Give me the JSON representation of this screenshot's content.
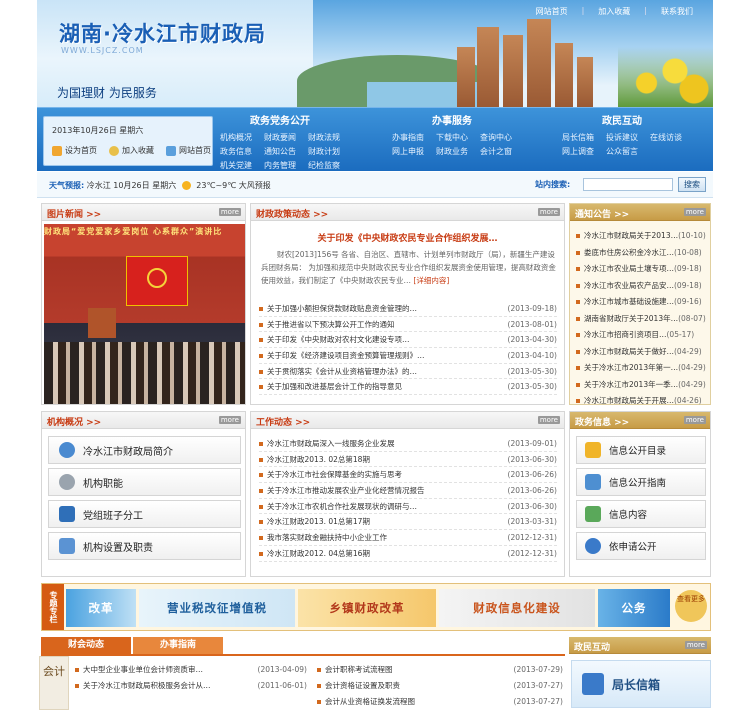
{
  "header": {
    "title": "湖南·冷水江市财政局",
    "subtitle_en": "WWW.LSJCZ.COM",
    "slogan": "为国理财    为民服务",
    "toplinks": [
      "网站首页",
      "加入收藏",
      "联系我们"
    ]
  },
  "datebox": {
    "date": "2013年10月26日  星期六",
    "quick": [
      "设为首页",
      "加入收藏",
      "网站首页"
    ]
  },
  "nav": [
    {
      "title": "政务党务公开",
      "items": [
        "机构概况",
        "财政要闻",
        "财政法规",
        "政务信息",
        "通知公告",
        "财政计划",
        "机关党建",
        "内务管理",
        "纪检监察"
      ]
    },
    {
      "title": "办事服务",
      "items": [
        "办事指南",
        "下载中心",
        "查询中心",
        "网上申报",
        "财政业务",
        "会计之窗"
      ]
    },
    {
      "title": "政民互动",
      "items": [
        "局长信箱",
        "投诉建议",
        "在线访谈",
        "网上调查",
        "公众留言"
      ]
    }
  ],
  "weather": {
    "label": "天气预报:",
    "text_left": "冷水江  10月26日  星期六",
    "temp": "23℃~9℃",
    "cond": "大风预报",
    "search_label": "站内搜索:",
    "search_placeholder": "",
    "search_btn": "搜索"
  },
  "photo_news": {
    "title": "图片新闻 >>",
    "more": "more",
    "banner": "财政局“爱党爱家乡爱岗位 心系群众”演讲比"
  },
  "policy": {
    "title": "财政政策动态 >>",
    "more": "more",
    "headline": "关于印发《中央财政农民专业合作组织发展…",
    "body_1": "财农[2013]156号 各省、自治区、直辖市、计划单列市财政厅（局），新疆生产建设兵团财务局：",
    "body_2": "为加强和规范中央财政农民专业合作组织发展资金使用管理，提高财政资金使用效益，我们制定了《中央财政农民专业…",
    "body_more": "[详细内容]",
    "items": [
      {
        "t": "关于加强小额担保贷款财政贴息资金管理的…",
        "d": "(2013-09-18)"
      },
      {
        "t": "关于推进省以下预决算公开工作的通知",
        "d": "(2013-08-01)"
      },
      {
        "t": "关于印发《中央财政对农村文化建设专项…",
        "d": "(2013-04-30)"
      },
      {
        "t": "关于印发《经济建设项目资金预算管理规则》…",
        "d": "(2013-04-10)"
      },
      {
        "t": "关于贯彻落实《会计从业资格管理办法》的…",
        "d": "(2013-05-30)"
      },
      {
        "t": "关于加强和改进基层会计工作的指导意见",
        "d": "(2013-05-30)"
      }
    ]
  },
  "notice": {
    "title": "通知公告 >>",
    "more": "more",
    "items": [
      {
        "t": "冷水江市财政局关于2013…",
        "d": "(10-10)"
      },
      {
        "t": "娄底市住房公积金冷水江…",
        "d": "(10-08)"
      },
      {
        "t": "冷水江市农业局土壤专项…",
        "d": "(09-18)"
      },
      {
        "t": "冷水江市农业局农产品安…",
        "d": "(09-18)"
      },
      {
        "t": "冷水江市城市基础设施建…",
        "d": "(09-16)"
      },
      {
        "t": "湖南省财政厅关于2013年…",
        "d": "(08-07)"
      },
      {
        "t": "冷水江市招商引资项目…",
        "d": "(05-17)"
      },
      {
        "t": "冷水江市财政局关于做好…",
        "d": "(04-29)"
      },
      {
        "t": "关于冷水江市2013年第一…",
        "d": "(04-29)"
      },
      {
        "t": "关于冷水江市2013年一季…",
        "d": "(04-29)"
      },
      {
        "t": "冷水江市财政局关于开展…",
        "d": "(04-26)"
      }
    ]
  },
  "org": {
    "title": "机构概况 >>",
    "more": "more",
    "items": [
      "冷水江市财政局简介",
      "机构职能",
      "党组班子分工",
      "机构设置及职责"
    ]
  },
  "work": {
    "title": "工作动态 >>",
    "more": "more",
    "items": [
      {
        "t": "冷水江市财政局深入一线服务企业发展",
        "d": "(2013-09-01)"
      },
      {
        "t": "冷水江财政2013. 02总第18期",
        "d": "(2013-06-30)"
      },
      {
        "t": "关于冷水江市社会保障基金的实施与思考",
        "d": "(2013-06-26)"
      },
      {
        "t": "关于冷水江市推动发展农业产业化经营情况报告",
        "d": "(2013-06-26)"
      },
      {
        "t": "关于冷水江市农机合作社发展现状的调研与…",
        "d": "(2013-06-30)"
      },
      {
        "t": "冷水江财政2013. 01总第17期",
        "d": "(2013-03-31)"
      },
      {
        "t": "我市落实财政金融扶持中小企业工作",
        "d": "(2012-12-31)"
      },
      {
        "t": "冷水江财政2012. 04总第16期",
        "d": "(2012-12-31)"
      }
    ]
  },
  "govinfo": {
    "title": "政务信息 >>",
    "more": "more",
    "items": [
      "信息公开目录",
      "信息公开指南",
      "信息内容",
      "依申请公开"
    ]
  },
  "strip": {
    "label": "专题专栏",
    "items": [
      "改革",
      "营业税改征增值税",
      "乡镇财政改革",
      "财政信息化建设",
      "公务"
    ],
    "more": "查看更多"
  },
  "bottom": {
    "tab1": "财会动态",
    "tab2": "办事指南",
    "side_label": "会计",
    "left_items": [
      {
        "t": "大中型企业事业单位会计师资质审…",
        "d": "(2013-04-09)"
      },
      {
        "t": "关于冷水江市财政局积极服务会计从…",
        "d": "(2011-06-01)"
      }
    ],
    "right_items": [
      {
        "t": "会计职称考试流程图",
        "d": "(2013-07-29)"
      },
      {
        "t": "会计资格证设置及职责",
        "d": "(2013-07-27)"
      },
      {
        "t": "会计从业资格证换发流程图",
        "d": "(2013-07-27)"
      }
    ],
    "interact_title": "政民互动",
    "interact_more": "more",
    "leader_mailbox": "局长信箱"
  }
}
